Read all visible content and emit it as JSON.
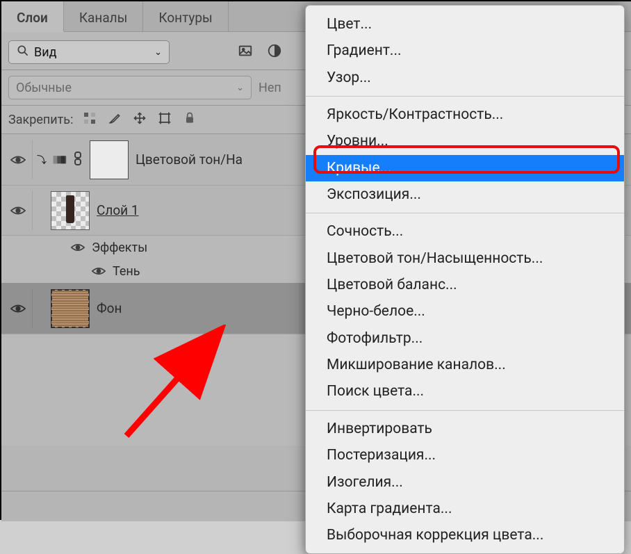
{
  "tabs": [
    {
      "label": "Слои",
      "active": true
    },
    {
      "label": "Каналы",
      "active": false
    },
    {
      "label": "Контуры",
      "active": false
    }
  ],
  "filterSelect": "Вид",
  "blendMode": "Обычные",
  "opacityLabel": "Неп",
  "lockLabel": "Закрепить:",
  "layers": {
    "adjustment": {
      "name": "Цветовой тон/На"
    },
    "layer1": {
      "name": "Слой 1"
    },
    "effects": "Эффекты",
    "shadow": "Тень",
    "background": {
      "name": "Фон"
    }
  },
  "menuGroups": [
    [
      "Цвет...",
      "Градиент...",
      "Узор..."
    ],
    [
      "Яркость/Контрастность...",
      "Уровни...",
      "Кривые...",
      "Экспозиция..."
    ],
    [
      "Сочность...",
      "Цветовой тон/Насыщенность...",
      "Цветовой баланс...",
      "Черно-белое...",
      "Фотофильтр...",
      "Микширование каналов...",
      "Поиск цвета..."
    ],
    [
      "Инвертировать",
      "Постеризация...",
      "Изогелия...",
      "Карта градиента...",
      "Выборочная коррекция цвета..."
    ]
  ],
  "highlighted": "Кривые..."
}
